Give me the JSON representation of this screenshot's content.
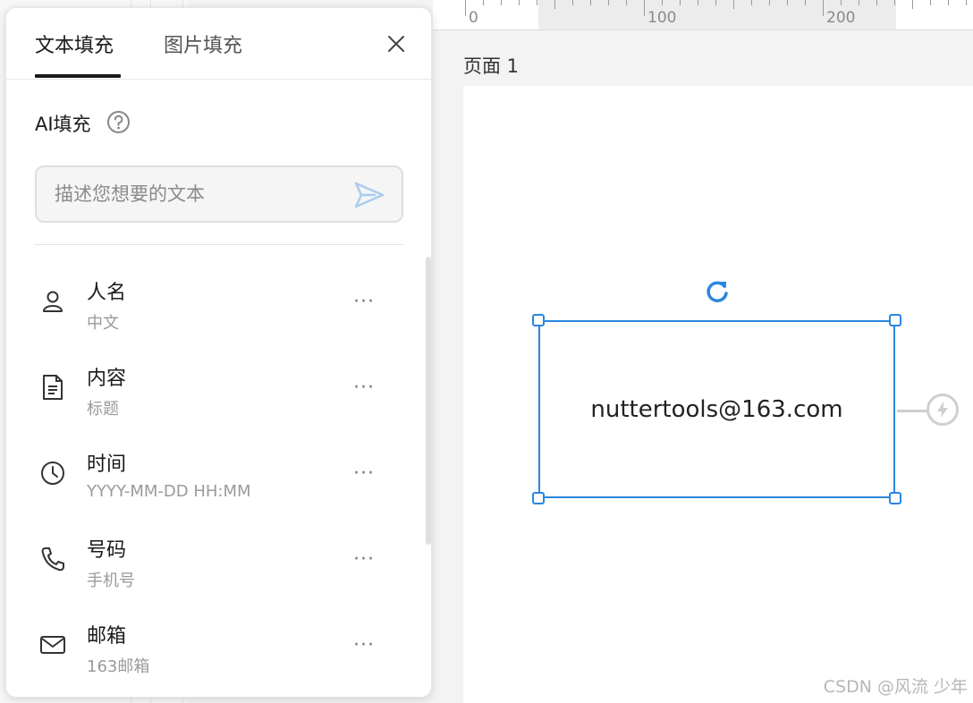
{
  "ruler": {
    "labels": [
      "0",
      "100",
      "200"
    ]
  },
  "canvas": {
    "page_label": "页面 1",
    "text_box": "nuttertools@163.com"
  },
  "panel": {
    "tabs": [
      {
        "label": "文本填充",
        "active": true
      },
      {
        "label": "图片填充",
        "active": false
      }
    ],
    "ai": {
      "title": "AI填充",
      "placeholder": "描述您想要的文本"
    },
    "items": [
      {
        "icon": "person-icon",
        "title": "人名",
        "subtitle": "中文"
      },
      {
        "icon": "document-icon",
        "title": "内容",
        "subtitle": "标题"
      },
      {
        "icon": "clock-icon",
        "title": "时间",
        "subtitle": "YYYY-MM-DD HH:MM"
      },
      {
        "icon": "phone-icon",
        "title": "号码",
        "subtitle": "手机号"
      },
      {
        "icon": "mail-icon",
        "title": "邮箱",
        "subtitle": "163邮箱"
      }
    ],
    "more_label": "···"
  },
  "watermark": "CSDN @风流 少年",
  "colors": {
    "accent": "#2a86de",
    "send_icon": "#a9ccee"
  }
}
